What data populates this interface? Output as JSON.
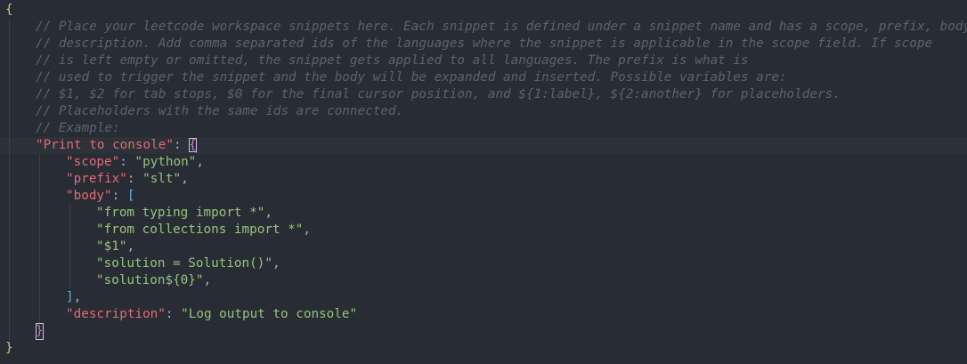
{
  "editor": {
    "open_brace": "{",
    "close_brace": "}",
    "comments": [
      "// Place your leetcode workspace snippets here. Each snippet is defined under a snippet name and has a scope, prefix, body a",
      "// description. Add comma separated ids of the languages where the snippet is applicable in the scope field. If scope",
      "// is left empty or omitted, the snippet gets applied to all languages. The prefix is what is",
      "// used to trigger the snippet and the body will be expanded and inserted. Possible variables are:",
      "// $1, $2 for tab stops, $0 for the final cursor position, and ${1:label}, ${2:another} for placeholders.",
      "// Placeholders with the same ids are connected.",
      "// Example:"
    ],
    "snippet": {
      "name": "\"Print to console\"",
      "colon": ": ",
      "open": "{",
      "close": "}",
      "scope_key": "\"scope\"",
      "scope_value": "\"python\"",
      "prefix_key": "\"prefix\"",
      "prefix_value": "\"slt\"",
      "body_key": "\"body\"",
      "body_open": "[",
      "body_close": "]",
      "body_lines": [
        "\"from typing import *\"",
        "\"from collections import *\"",
        "\"$1\"",
        "\"solution = Solution()\"",
        "\"solution${0}\""
      ],
      "description_key": "\"description\"",
      "description_value": "\"Log output to console\"",
      "comma": ","
    },
    "colors": {
      "background": "#282c34",
      "comment": "#5c6370",
      "key": "#e06c75",
      "string": "#98c379",
      "bracket_outer": "#e5c07b",
      "bracket_snippet": "#c678dd",
      "bracket_array": "#61afef"
    }
  }
}
